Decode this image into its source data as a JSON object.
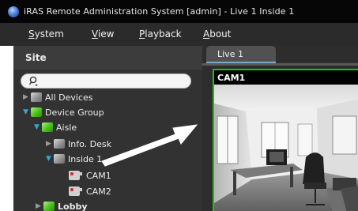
{
  "window": {
    "title": "iRAS Remote Administration System [admin] - Live 1   Inside 1"
  },
  "menu": [
    {
      "mnemonic": "S",
      "rest": "ystem"
    },
    {
      "mnemonic": "V",
      "rest": "iew"
    },
    {
      "mnemonic": "P",
      "rest": "layback"
    },
    {
      "mnemonic": "A",
      "rest": "bout"
    }
  ],
  "site_panel": {
    "title": "Site",
    "search_icon": "search-icon",
    "tree": [
      {
        "label": "All Devices",
        "icon": "devices-icon"
      },
      {
        "label": "Device Group",
        "icon": "group-icon"
      },
      {
        "label": "Aisle",
        "icon": "group-icon"
      },
      {
        "label": "Info. Desk",
        "icon": "device-icon"
      },
      {
        "label": "Inside 1",
        "icon": "device-icon"
      },
      {
        "label": "CAM1",
        "icon": "camera-icon"
      },
      {
        "label": "CAM2",
        "icon": "camera-icon"
      },
      {
        "label": "Lobby",
        "icon": "group-icon"
      }
    ]
  },
  "live": {
    "tab_label": "Live  1",
    "camera_label": "CAM1"
  },
  "colors": {
    "active_frame": "#1fc10b",
    "group_green": "#49c11d",
    "expand_arrow": "#2ea6d8"
  }
}
